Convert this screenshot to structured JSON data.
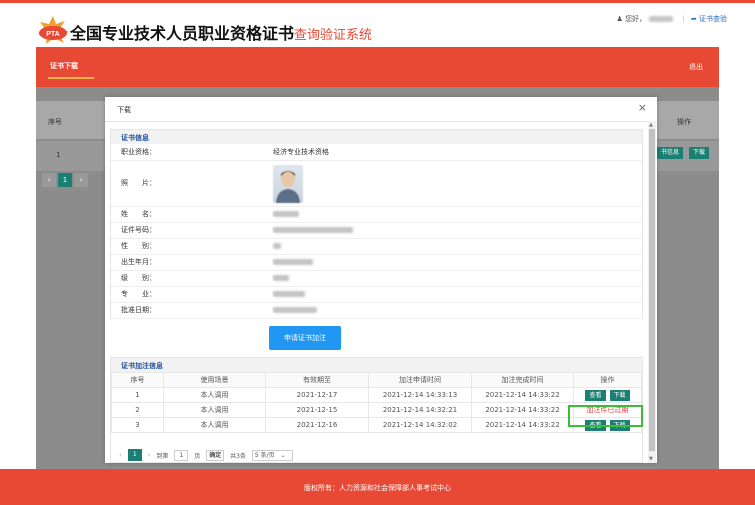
{
  "header": {
    "logo_text": "PTA",
    "title_main": "全国专业技术人员职业资格证书",
    "title_sub": "查询验证系统",
    "greeting": "您好，",
    "cert_check_link": "证书查验"
  },
  "nav": {
    "tab": "证书下载",
    "logout": "退出"
  },
  "background_page": {
    "col_index": "序号",
    "col_op": "操作",
    "row_index": "1",
    "view_btn": "书信息",
    "download_btn": "下载",
    "page_current": "1"
  },
  "modal": {
    "title": "下载",
    "close": "×",
    "cert_info_title": "证书信息",
    "fields": {
      "qualification_label": "职业资格：",
      "qualification_value": "经济专业技术资格",
      "photo_label": "照　　片：",
      "name_label": "姓　　名：",
      "cert_no_label": "证件号码：",
      "gender_label": "性　　别：",
      "birth_label": "出生年月：",
      "level_label": "级　　别：",
      "major_label": "专　　业：",
      "approve_label": "批准日期："
    },
    "apply_button": "申请证书加注",
    "annot_title": "证书加注信息",
    "annot_columns": [
      "序号",
      "使用场景",
      "有效期至",
      "加注申请时间",
      "加注完成时间",
      "操作"
    ],
    "annot_rows": [
      {
        "index": "1",
        "scene": "本人调用",
        "valid_until": "2021-12-17",
        "apply_time": "2021-12-14 14:33:13",
        "done_time": "2021-12-14 14:33:22"
      },
      {
        "index": "2",
        "scene": "本人调用",
        "valid_until": "2021-12-15",
        "apply_time": "2021-12-14 14:32:21",
        "done_time": "2021-12-14 14:33:22"
      },
      {
        "index": "3",
        "scene": "本人调用",
        "valid_until": "2021-12-16",
        "apply_time": "2021-12-14 14:32:02",
        "done_time": "2021-12-14 14:33:22"
      }
    ],
    "view_btn": "查看",
    "download_btn": "下载",
    "expired_text": "加注件已过期",
    "pager": {
      "current": "1",
      "goto_label": "到第",
      "goto_value": "1",
      "page_unit": "页",
      "ok": "确定",
      "total": "共3条",
      "per_page": "5 条/页"
    }
  },
  "footer": {
    "copyright": "版权所有：人力资源和社会保障部人事考试中心"
  },
  "colors": {
    "brand_red": "#e84935",
    "action_green": "#1b7f73",
    "primary_blue": "#2196f3",
    "highlight_green": "#3dbb3a"
  }
}
